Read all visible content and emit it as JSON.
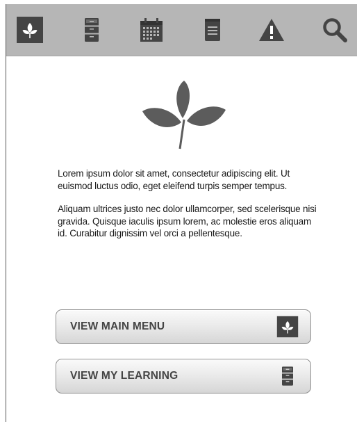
{
  "toolbar": {
    "icons": [
      "leaf-logo-icon",
      "file-cabinet-icon",
      "calendar-icon",
      "notepad-icon",
      "warning-icon",
      "search-icon"
    ]
  },
  "content": {
    "paragraph_1": "Lorem ipsum dolor sit amet, consectetur adipiscing elit. Ut euismod luctus odio, eget eleifend turpis semper tempus.",
    "paragraph_2": "Aliquam ultrices justo nec dolor ullamcorper, sed scelerisque nisi gravida. Quisque iaculis ipsum lorem, ac molestie eros aliquam id. Curabitur dignissim vel orci a pellentesque."
  },
  "buttons": {
    "main_menu": {
      "label": "VIEW MAIN MENU",
      "icon": "leaf-logo-icon"
    },
    "my_learning": {
      "label": "VIEW MY LEARNING",
      "icon": "file-cabinet-icon"
    }
  },
  "colors": {
    "toolbar_bg": "#b6b6b6",
    "icon_dark": "#444444",
    "leaf_gray": "#5c5c5c",
    "button_border": "#8e8e8e"
  }
}
